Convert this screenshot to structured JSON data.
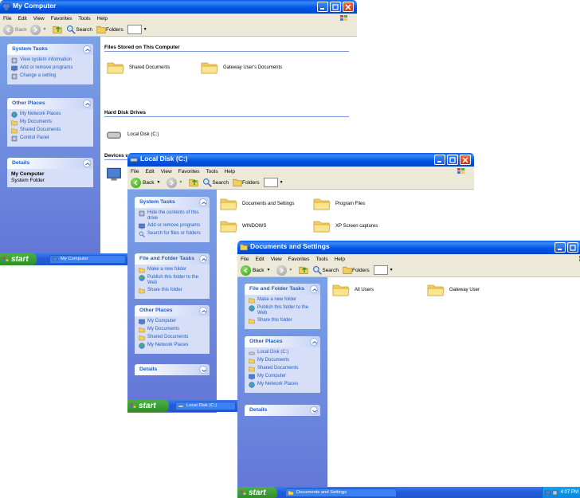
{
  "colors": {
    "title_blue": "#0058e6",
    "panel_blue": "#6f8fe0",
    "link_blue": "#215dc6",
    "start_green": "#3a9c2f"
  },
  "win1": {
    "title": "My Computer",
    "menu": [
      "File",
      "Edit",
      "View",
      "Favorites",
      "Tools",
      "Help"
    ],
    "toolbar": {
      "back": "Back",
      "search": "Search",
      "folders": "Folders"
    },
    "system_tasks": {
      "title": "System Tasks",
      "items": [
        "View system information",
        "Add or remove programs",
        "Change a setting"
      ]
    },
    "other_places": {
      "title": "Other Places",
      "items": [
        "My Network Places",
        "My Documents",
        "Shared Documents",
        "Control Panel"
      ]
    },
    "details": {
      "title": "Details",
      "name": "My Computer",
      "type": "System Folder"
    },
    "sections": {
      "files": "Files Stored on This Computer",
      "hdd": "Hard Disk Drives",
      "devices": "Devices w"
    },
    "items": {
      "shared": "Shared Documents",
      "gateway_docs": "Gateway User's Documents",
      "local_disk": "Local Disk (C:)"
    }
  },
  "win2": {
    "title": "Local Disk (C:)",
    "menu": [
      "File",
      "Edit",
      "View",
      "Favorites",
      "Tools",
      "Help"
    ],
    "toolbar": {
      "back": "Back",
      "search": "Search",
      "folders": "Folders"
    },
    "system_tasks": {
      "title": "System Tasks",
      "items": [
        "Hide the contents of this drive",
        "Add or remove programs",
        "Search for files or folders"
      ]
    },
    "file_tasks": {
      "title": "File and Folder Tasks",
      "items": [
        "Make a new folder",
        "Publish this folder to the Web",
        "Share this folder"
      ]
    },
    "other_places": {
      "title": "Other Places",
      "items": [
        "My Computer",
        "My Documents",
        "Shared Documents",
        "My Network Places"
      ]
    },
    "details": {
      "title": "Details"
    },
    "items": [
      "Documents and Settings",
      "Program Files",
      "WINDOWS",
      "XP Screen captures"
    ]
  },
  "win3": {
    "title": "Documents and Settings",
    "menu": [
      "File",
      "Edit",
      "View",
      "Favorites",
      "Tools",
      "Help"
    ],
    "toolbar": {
      "back": "Back",
      "search": "Search",
      "folders": "Folders"
    },
    "file_tasks": {
      "title": "File and Folder Tasks",
      "items": [
        "Make a new folder",
        "Publish this folder to the Web",
        "Share this folder"
      ]
    },
    "other_places": {
      "title": "Other Places",
      "items": [
        "Local Disk (C:)",
        "My Documents",
        "Shared Documents",
        "My Computer",
        "My Network Places"
      ]
    },
    "details": {
      "title": "Details"
    },
    "items": [
      "All Users",
      "Gateway User"
    ]
  },
  "taskbars": {
    "start_label": "start",
    "task1": "My Computer",
    "task2": "Local Disk (C:)",
    "task3": "Documents and Settings",
    "clock": "4:07 PM"
  }
}
